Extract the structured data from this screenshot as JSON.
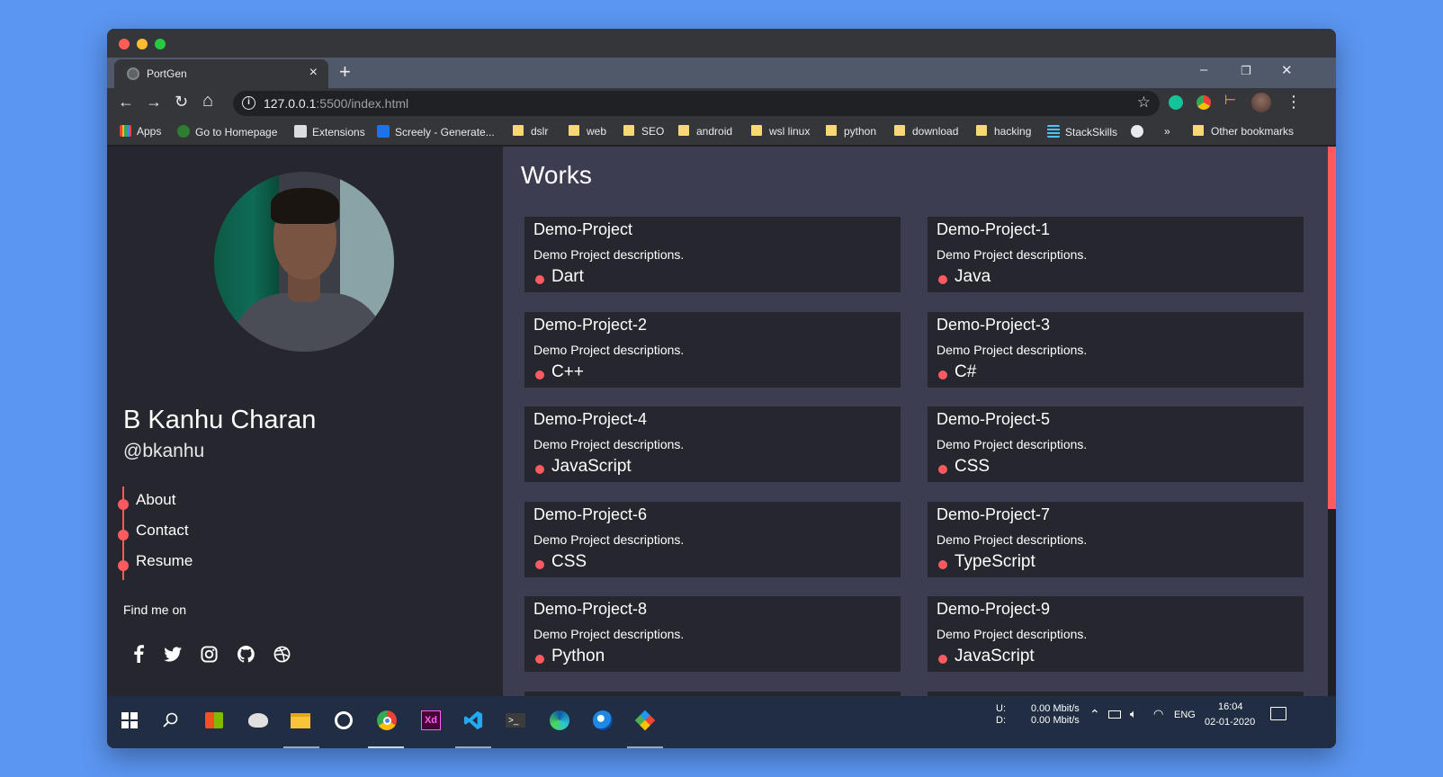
{
  "browser": {
    "tab_title": "PortGen",
    "tab_close": "×",
    "new_tab": "+",
    "url_host": "127.0.0.1",
    "url_path": ":5500/index.html",
    "info_glyph": "i",
    "win_minimize": "–",
    "win_restore": "❐",
    "win_close": "✕",
    "nav_back": "←",
    "nav_forward": "→",
    "nav_reload": "↻",
    "nav_home": "⌂",
    "star": "☆",
    "menu": "⋮",
    "bookmarks": {
      "apps": "Apps",
      "homepage": "Go to Homepage",
      "extensions": "Extensions",
      "screely": "Screely - Generate...",
      "dslr": "dslr",
      "web": "web",
      "seo": "SEO",
      "android": "android",
      "wsl": "wsl linux",
      "python": "python",
      "download": "download",
      "hacking": "hacking",
      "stackskills": "StackSkills",
      "overflow": "»",
      "other": "Other bookmarks"
    }
  },
  "profile": {
    "name": "B Kanhu Charan",
    "handle": "@bkanhu",
    "nav": [
      "About",
      "Contact",
      "Resume"
    ],
    "find_me": "Find me on",
    "social_icons": [
      "facebook-icon",
      "twitter-icon",
      "instagram-icon",
      "github-icon",
      "dribbble-icon"
    ]
  },
  "works": {
    "title": "Works",
    "projects": [
      {
        "title": "Demo-Project",
        "description": "Demo Project descriptions.",
        "language": "Dart"
      },
      {
        "title": "Demo-Project-1",
        "description": "Demo Project descriptions.",
        "language": "Java"
      },
      {
        "title": "Demo-Project-2",
        "description": "Demo Project descriptions.",
        "language": "C++"
      },
      {
        "title": "Demo-Project-3",
        "description": "Demo Project descriptions.",
        "language": "C#"
      },
      {
        "title": "Demo-Project-4",
        "description": "Demo Project descriptions.",
        "language": "JavaScript"
      },
      {
        "title": "Demo-Project-5",
        "description": "Demo Project descriptions.",
        "language": "CSS"
      },
      {
        "title": "Demo-Project-6",
        "description": "Demo Project descriptions.",
        "language": "CSS"
      },
      {
        "title": "Demo-Project-7",
        "description": "Demo Project descriptions.",
        "language": "TypeScript"
      },
      {
        "title": "Demo-Project-8",
        "description": "Demo Project descriptions.",
        "language": "Python"
      },
      {
        "title": "Demo-Project-9",
        "description": "Demo Project descriptions.",
        "language": "JavaScript"
      }
    ]
  },
  "taskbar": {
    "net_up_label": "U:",
    "net_down_label": "D:",
    "net_up": "0.00 Mbit/s",
    "net_down": "0.00 Mbit/s",
    "lang": "ENG",
    "time": "16:04",
    "date": "02-01-2020",
    "xd_label": "Xd"
  },
  "colors": {
    "accent": "#ff5a5f",
    "sidebar_bg": "#25262e",
    "main_bg": "#3c3d50",
    "card_bg": "#25262e",
    "desktop_bg": "#5b96f2"
  }
}
